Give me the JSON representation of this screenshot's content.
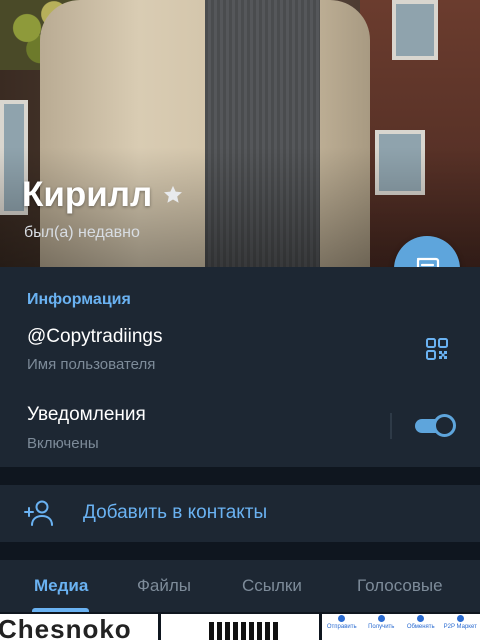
{
  "profile": {
    "name": "Кирилл",
    "status": "был(а) недавно"
  },
  "info": {
    "section_title": "Информация",
    "username": "@Copytradiings",
    "username_caption": "Имя пользователя",
    "notifications_label": "Уведомления",
    "notifications_state": "Включены",
    "notifications_enabled": true
  },
  "actions": {
    "add_contact": "Добавить в контакты"
  },
  "tabs": [
    {
      "label": "Медиа",
      "active": true
    },
    {
      "label": "Файлы",
      "active": false
    },
    {
      "label": "Ссылки",
      "active": false
    },
    {
      "label": "Голосовые",
      "active": false
    }
  ],
  "media": {
    "thumb1_text": "Chesnoko",
    "thumb3_buttons": [
      "Отправить",
      "Получить",
      "Обменять",
      "P2P Маркет"
    ]
  },
  "colors": {
    "accent": "#6ab2f2",
    "fab": "#5ea5dc",
    "panel": "#1d2733",
    "background": "#0f161f",
    "caption": "#7d8b99"
  },
  "icons": {
    "star": "star-icon",
    "message": "message-icon",
    "qr": "qr-code-icon",
    "add_user": "add-user-icon"
  }
}
